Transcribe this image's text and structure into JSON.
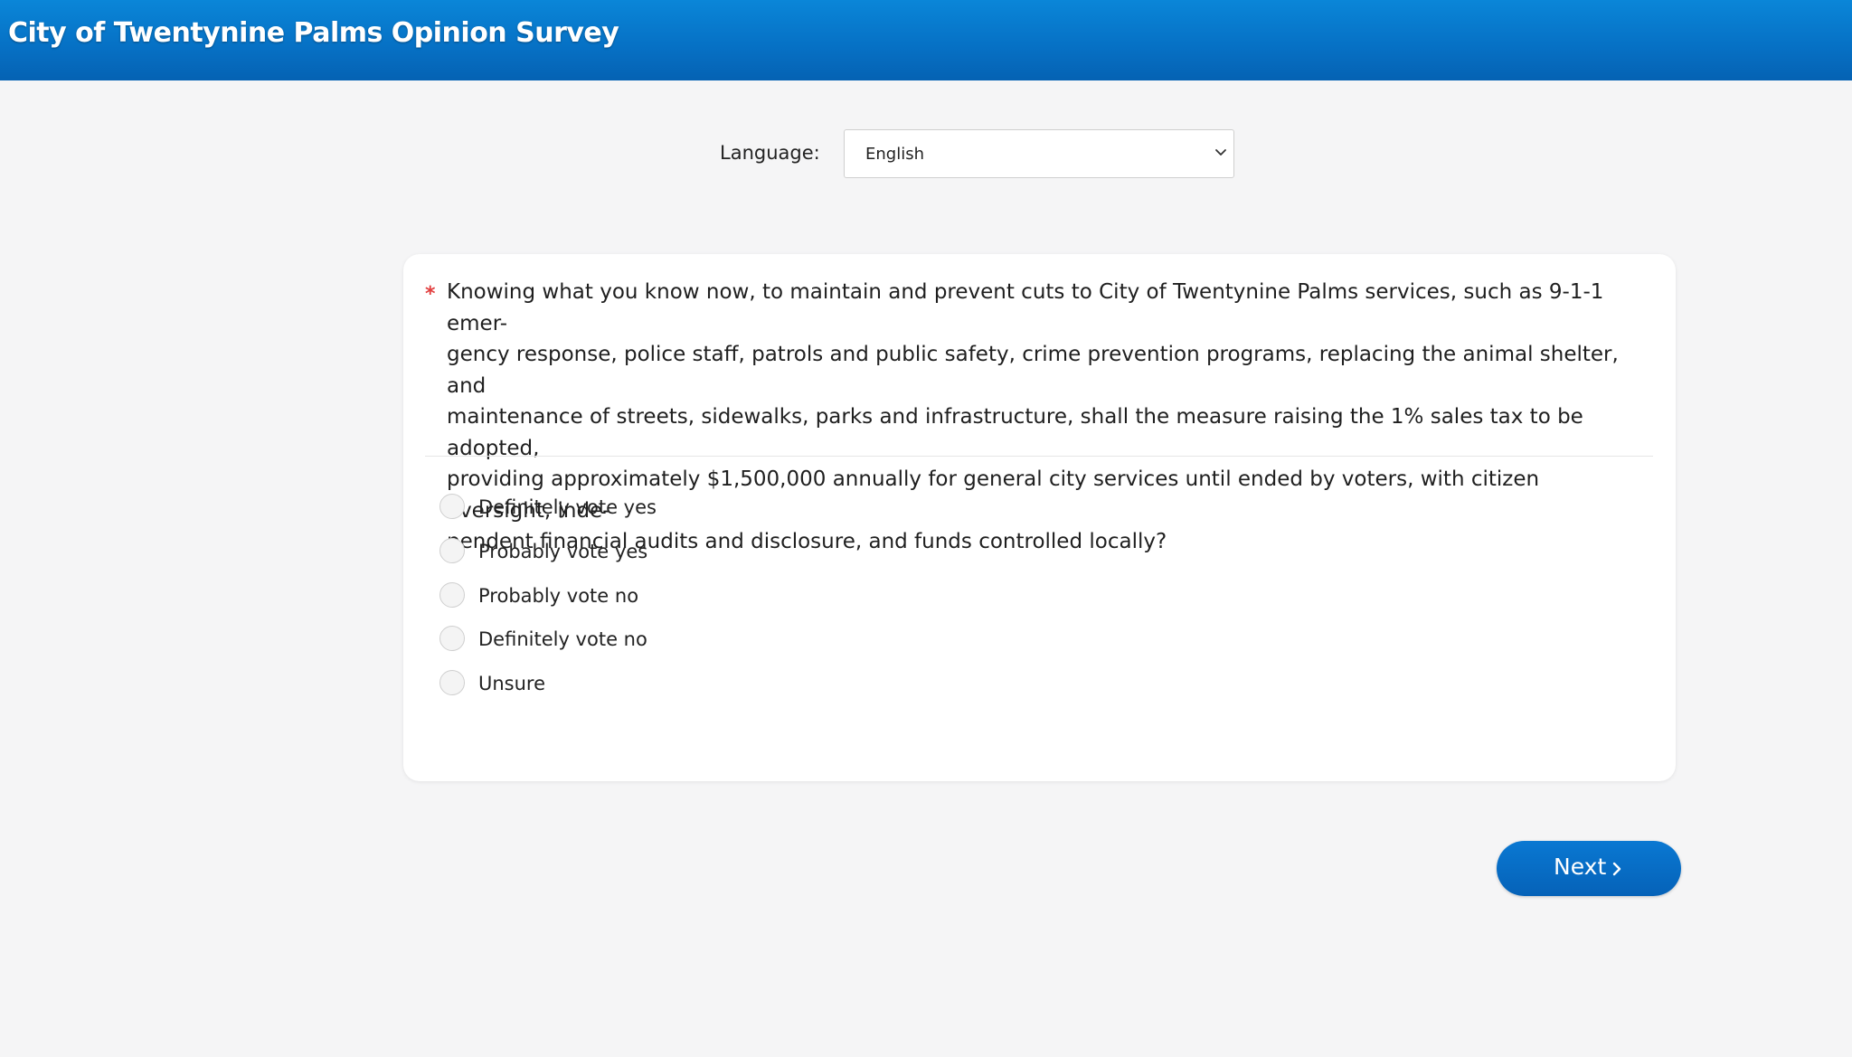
{
  "header": {
    "title": "City of Twentynine Palms Opinion Survey",
    "background_color": "#0670c4"
  },
  "language": {
    "label": "Language:",
    "selected": "English"
  },
  "question": {
    "required_marker": "*",
    "text": "Knowing what you know now, to maintain and prevent cuts to City of Twentynine Palms services, such as 9-1-1 emer-gency response, police staff, patrols and public safety, crime prevention programs, replacing the animal shelter, and maintenance of streets, sidewalks, parks and infrastructure, shall the measure raising the 1% sales tax to be adopted, providing approximately $1,500,000 annually for general city services until ended by voters, with citizen oversight, inde-pendent financial audits and disclosure, and funds controlled locally?",
    "lines": [
      "Knowing what you know now, to maintain and prevent cuts to City of Twentynine Palms services, such as 9-1-1 emer-",
      "gency response, police staff, patrols and public safety, crime prevention programs, replacing the animal shelter, and",
      "maintenance of streets, sidewalks, parks and infrastructure, shall the measure raising the 1% sales tax to be adopted,",
      "providing approximately $1,500,000 annually for general city services until ended by voters, with citizen oversight, inde-",
      "pendent financial audits and disclosure, and funds controlled locally?"
    ],
    "required_color": "#e24040"
  },
  "options": [
    {
      "label": "Definitely vote yes",
      "selected": false
    },
    {
      "label": "Probably vote yes",
      "selected": false
    },
    {
      "label": "Probably vote no",
      "selected": false
    },
    {
      "label": "Definitely vote no",
      "selected": false
    },
    {
      "label": "Unsure",
      "selected": false
    }
  ],
  "navigation": {
    "next_label": "Next",
    "next_icon": "chevron-right-icon",
    "button_color": "#0a6fc8"
  }
}
